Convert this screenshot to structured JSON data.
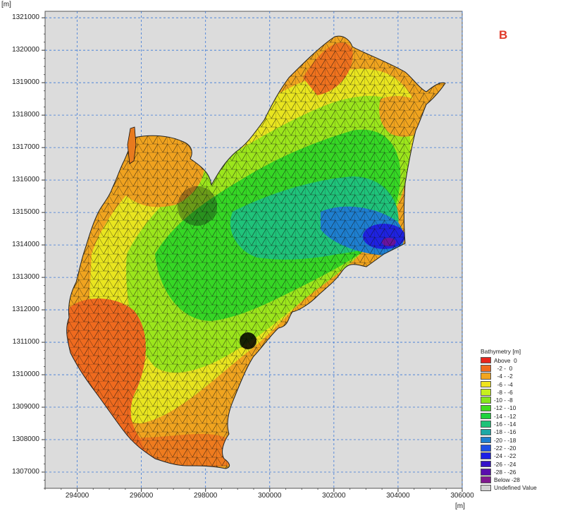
{
  "map": {
    "y_unit": "[m]",
    "x_unit": "[m]",
    "panel_label": "B",
    "y_ticks": [
      "1321000",
      "1320000",
      "1319000",
      "1318000",
      "1317000",
      "1316000",
      "1315000",
      "1314000",
      "1313000",
      "1312000",
      "1311000",
      "1310000",
      "1309000",
      "1308000",
      "1307000"
    ],
    "x_ticks": [
      "294000",
      "296000",
      "298000",
      "300000",
      "302000",
      "304000",
      "306000"
    ],
    "x_range": [
      293000,
      306000
    ],
    "y_range": [
      1306500,
      1321200
    ],
    "background_color": "#dcdcdc",
    "grid_color": "#3a78d8"
  },
  "legend": {
    "title": "Bathymetry [m]",
    "entries": [
      {
        "label": "Above  0",
        "color": "#e8251d"
      },
      {
        "label": "  -2 -  0",
        "color": "#f06a1d"
      },
      {
        "label": "  -4 - -2",
        "color": "#f2a51e"
      },
      {
        "label": "  -6 - -4",
        "color": "#efe41e"
      },
      {
        "label": "  -8 - -6",
        "color": "#c6ef1e"
      },
      {
        "label": "-10 - -8",
        "color": "#86e61c"
      },
      {
        "label": "-12 - -10",
        "color": "#42dc1f"
      },
      {
        "label": "-14 - -12",
        "color": "#1fd23d"
      },
      {
        "label": "-16 - -14",
        "color": "#1fc278"
      },
      {
        "label": "-18 - -16",
        "color": "#1ea9a6"
      },
      {
        "label": "-20 - -18",
        "color": "#1e7fcf"
      },
      {
        "label": "-22 - -20",
        "color": "#1e4fe6"
      },
      {
        "label": "-24 - -22",
        "color": "#1e20e6"
      },
      {
        "label": "-26 - -24",
        "color": "#3512c9"
      },
      {
        "label": "-28 - -26",
        "color": "#5a0fad"
      },
      {
        "label": "Below -28",
        "color": "#801a8f"
      },
      {
        "label": "Undefined Value",
        "color": "#d3d3d3"
      }
    ]
  }
}
